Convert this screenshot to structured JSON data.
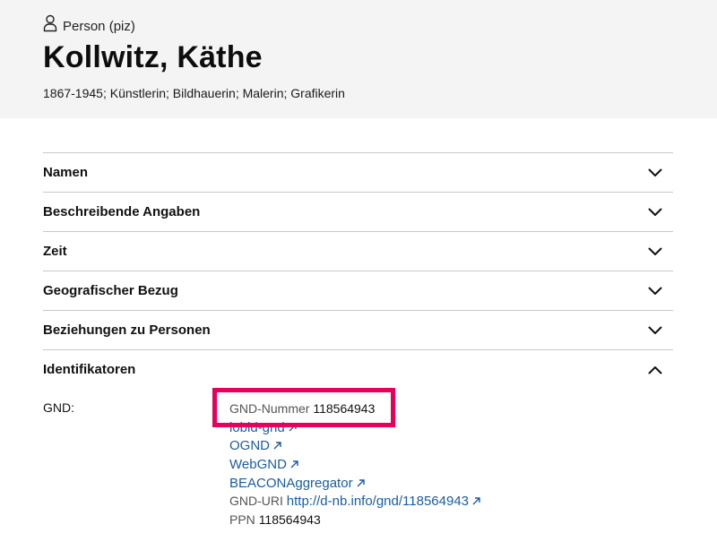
{
  "header": {
    "entity_icon": "person-icon",
    "entity_type": "Person (piz)",
    "title": "Kollwitz, Käthe",
    "subtitle": "1867-1945; Künstlerin; Bildhauerin; Malerin; Grafikerin"
  },
  "sections": [
    {
      "label": "Namen",
      "expanded": false,
      "icon": "chevron-down-icon"
    },
    {
      "label": "Beschreibende Angaben",
      "expanded": false,
      "icon": "chevron-down-icon"
    },
    {
      "label": "Zeit",
      "expanded": false,
      "icon": "chevron-down-icon"
    },
    {
      "label": "Geografischer Bezug",
      "expanded": false,
      "icon": "chevron-down-icon"
    },
    {
      "label": "Beziehungen zu Personen",
      "expanded": false,
      "icon": "chevron-down-icon"
    },
    {
      "label": "Identifikatoren",
      "expanded": true,
      "icon": "chevron-up-icon"
    }
  ],
  "identifiers": {
    "group_label": "GND:",
    "gnd_number": {
      "label": "GND-Nummer",
      "value": "118564943",
      "highlighted": true
    },
    "links": [
      {
        "label": "lobid-gnd",
        "icon": "external-link-icon"
      },
      {
        "label": "OGND",
        "icon": "external-link-icon"
      },
      {
        "label": "WebGND",
        "icon": "external-link-icon"
      },
      {
        "label": "BEACONAggregator",
        "icon": "external-link-icon"
      }
    ],
    "gnd_uri": {
      "label": "GND-URI",
      "value": "http://d-nb.info/gnd/118564943",
      "icon": "external-link-icon"
    },
    "ppn": {
      "label": "PPN",
      "value": "118564943"
    }
  },
  "colors": {
    "header_background": "#f4f4f4",
    "link": "#1b5c9e",
    "divider": "#c9c9c9",
    "highlight_border": "#e6005c"
  }
}
